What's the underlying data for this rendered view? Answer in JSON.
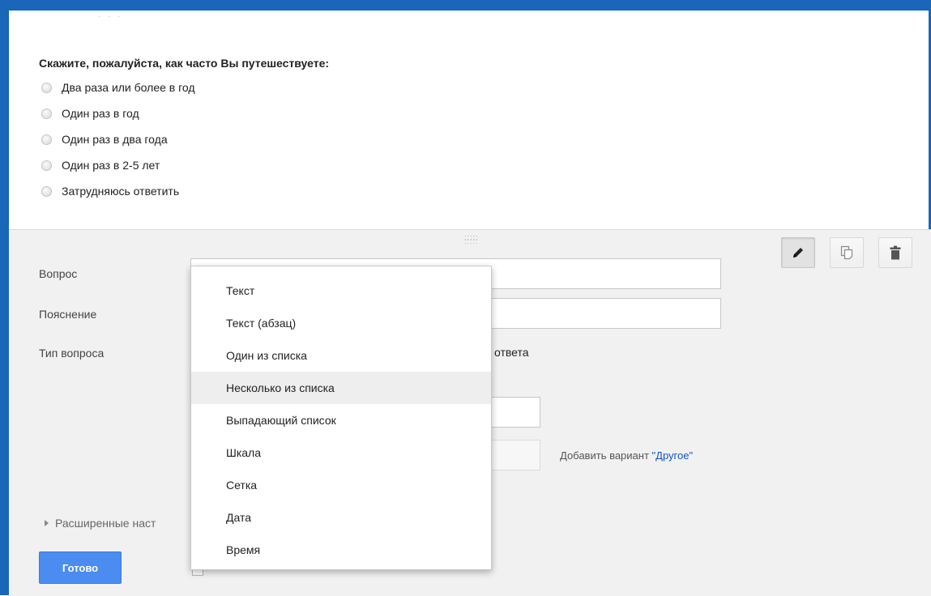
{
  "preview": {
    "question_title": "Скажите, пожалуйста, как часто Вы путешествуете:",
    "options": [
      "Два раза или более в год",
      "Один раз в год",
      "Один раз в два года",
      "Один раз в 2-5 лет",
      "Затрудняюсь ответить"
    ]
  },
  "editor": {
    "toolbar": {
      "edit_icon": "pencil-icon",
      "copy_icon": "copy-icon",
      "delete_icon": "trash-icon"
    },
    "question_label": "Вопрос",
    "hint_label": "Пояснение",
    "type_label": "Тип вопроса",
    "type_tail_text": "ответа",
    "add_other_prefix": "Добавить вариант ",
    "add_other_link": "\"Другое\"",
    "advanced_label": "Расширенные наст",
    "done_label": "Готово"
  },
  "dropdown": {
    "items": [
      "Текст",
      "Текст (абзац)",
      "Один из списка",
      "Несколько из списка",
      "Выпадающий список",
      "Шкала",
      "Сетка",
      "Дата",
      "Время"
    ],
    "highlighted": "Несколько из списка"
  },
  "colors": {
    "accent": "#1a66b8",
    "primary_button": "#4a8cf0",
    "link": "#1155cc"
  }
}
